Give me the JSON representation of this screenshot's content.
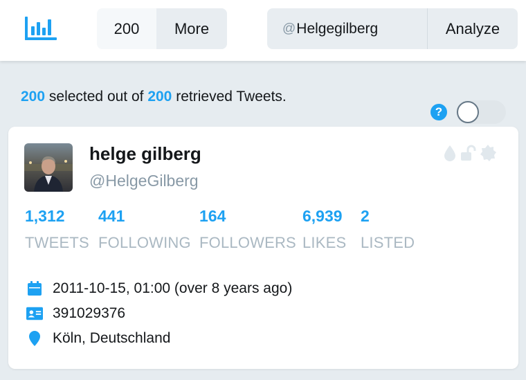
{
  "header": {
    "logo_icon": "bar-chart-icon",
    "count_value": "200",
    "more_label": "More",
    "search_at": "@",
    "search_value": "Helgegilberg",
    "analyze_label": "Analyze"
  },
  "summary": {
    "selected": "200",
    "middle_text": "selected out of",
    "retrieved": "200",
    "end_text": "retrieved Tweets."
  },
  "help_icon_label": "?",
  "profile": {
    "name": "helge gilberg",
    "handle": "@HelgeGilberg",
    "status_icons": [
      "drop-icon",
      "unlocked-icon",
      "gear-badge-icon"
    ],
    "stats": [
      {
        "value": "1,312",
        "label": "TWEETS"
      },
      {
        "value": "441",
        "label": "FOLLOWING"
      },
      {
        "value": "164",
        "label": "FOLLOWERS"
      },
      {
        "value": "6,939",
        "label": "LIKES"
      },
      {
        "value": "2",
        "label": "LISTED"
      }
    ],
    "created": "2011-10-15, 01:00 (over 8 years ago)",
    "user_id": "391029376",
    "location": "Köln, Deutschland"
  },
  "colors": {
    "accent": "#1da1f2",
    "muted": "#aab8c2",
    "background": "#e6ecf0"
  }
}
